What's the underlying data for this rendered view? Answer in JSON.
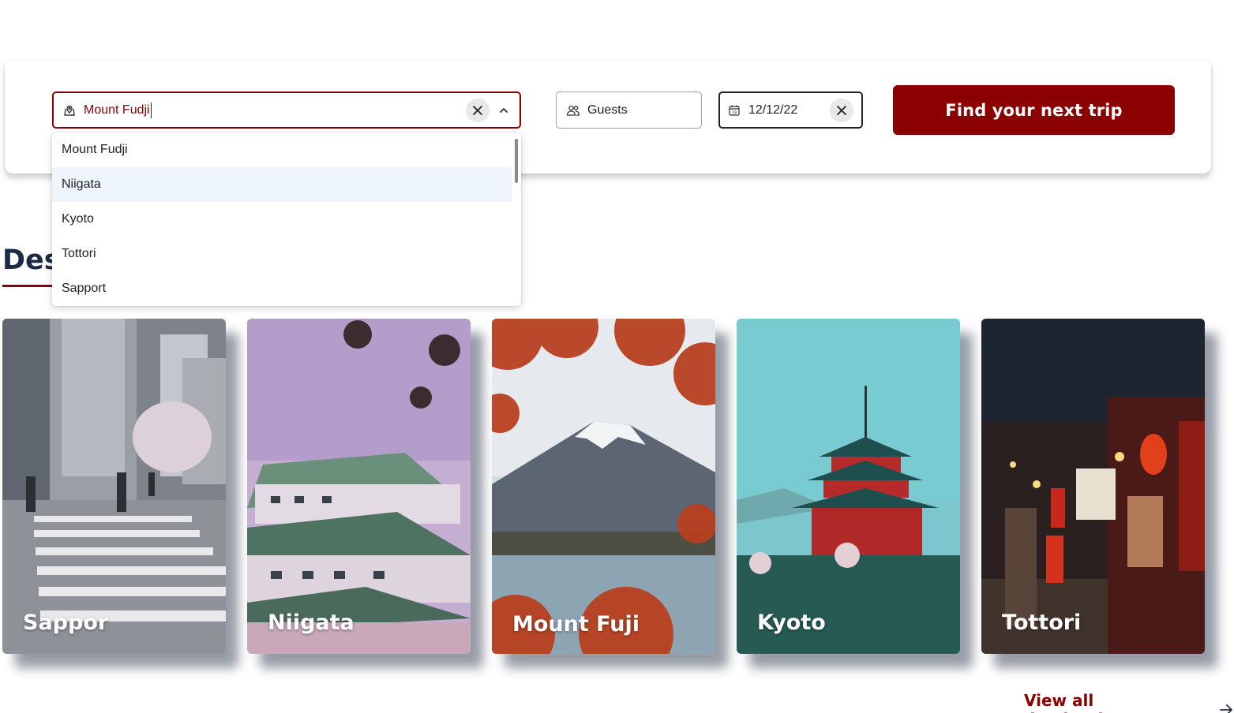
{
  "search": {
    "destination_value": "Mount Fudji",
    "guests_placeholder": "Guests",
    "date_value": "12/12/22",
    "find_button": "Find your next trip"
  },
  "dropdown": {
    "options": [
      "Mount Fudji",
      "Niigata",
      "Kyoto",
      "Tottori",
      "Sapport"
    ],
    "highlighted": "Niigata"
  },
  "section": {
    "title_visible": "Des"
  },
  "destinations": [
    {
      "label": "Sappor"
    },
    {
      "label": "Niigata"
    },
    {
      "label": "Mount Fuji"
    },
    {
      "label": "Kyoto"
    },
    {
      "label": "Tottori"
    }
  ],
  "footer": {
    "view_all": "View all destinations"
  },
  "colors": {
    "brand": "#8b0000",
    "heading": "#1c2b45",
    "highlight": "#eef5fd"
  },
  "icons": {
    "destination": "map-pin-icon",
    "guests": "users-icon",
    "date": "calendar-icon",
    "clear": "close-icon",
    "toggle": "chevron-up-icon",
    "view_all": "arrow-right-icon"
  }
}
